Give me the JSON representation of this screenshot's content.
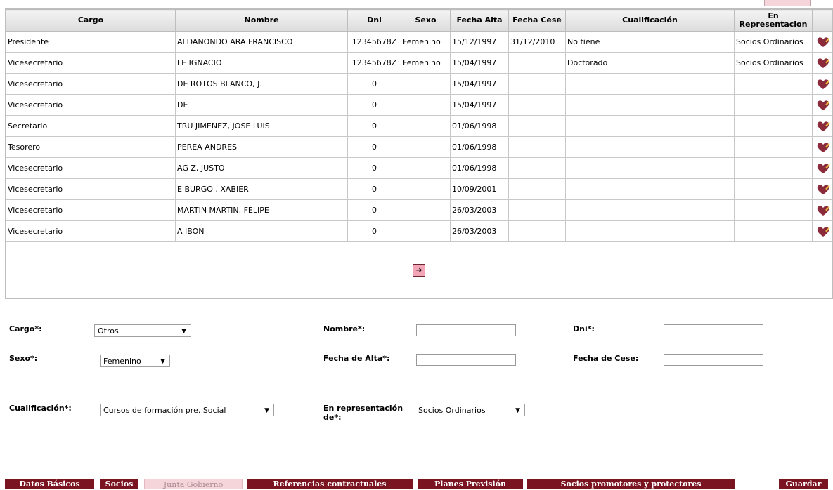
{
  "table": {
    "headers": {
      "cargo": "Cargo",
      "nombre": "Nombre",
      "dni": "Dni",
      "sexo": "Sexo",
      "fecha_alta": "Fecha Alta",
      "fecha_cese": "Fecha Cese",
      "cualificacion": "Cualificación",
      "en_representacion": "En Representacion"
    },
    "rows": [
      {
        "cargo": "Presidente",
        "nombre": "ALDANONDO ARA FRANCISCO",
        "dni": "12345678Z",
        "sexo": "Femenino",
        "fecha_alta": "15/12/1997",
        "fecha_cese": "31/12/2010",
        "cualificacion": "No tiene",
        "en_representacion": "Socios Ordinarios"
      },
      {
        "cargo": "Vicesecretario",
        "nombre": "LE          IGNACIO",
        "dni": "12345678Z",
        "sexo": "Femenino",
        "fecha_alta": "15/04/1997",
        "fecha_cese": "",
        "cualificacion": "Doctorado",
        "en_representacion": "Socios Ordinarios"
      },
      {
        "cargo": "Vicesecretario",
        "nombre": "DE  ROTOS BLANCO, J.",
        "dni": "0",
        "sexo": "",
        "fecha_alta": "15/04/1997",
        "fecha_cese": "",
        "cualificacion": "",
        "en_representacion": ""
      },
      {
        "cargo": "Vicesecretario",
        "nombre": "DE",
        "dni": "0",
        "sexo": "",
        "fecha_alta": "15/04/1997",
        "fecha_cese": "",
        "cualificacion": "",
        "en_representacion": ""
      },
      {
        "cargo": "Secretario",
        "nombre": "TRU   JIMENEZ, JOSE LUIS",
        "dni": "0",
        "sexo": "",
        "fecha_alta": "01/06/1998",
        "fecha_cese": "",
        "cualificacion": "",
        "en_representacion": ""
      },
      {
        "cargo": "Tesorero",
        "nombre": "PEREA   ANDRES",
        "dni": "0",
        "sexo": "",
        "fecha_alta": "01/06/1998",
        "fecha_cese": "",
        "cualificacion": "",
        "en_representacion": ""
      },
      {
        "cargo": "Vicesecretario",
        "nombre": "AG         Z, JUSTO",
        "dni": "0",
        "sexo": "",
        "fecha_alta": "01/06/1998",
        "fecha_cese": "",
        "cualificacion": "",
        "en_representacion": ""
      },
      {
        "cargo": "Vicesecretario",
        "nombre": "E       BURGO   , XABIER",
        "dni": "0",
        "sexo": "",
        "fecha_alta": "10/09/2001",
        "fecha_cese": "",
        "cualificacion": "",
        "en_representacion": ""
      },
      {
        "cargo": "Vicesecretario",
        "nombre": "MARTIN MARTIN, FELIPE",
        "dni": "0",
        "sexo": "",
        "fecha_alta": "26/03/2003",
        "fecha_cese": "",
        "cualificacion": "",
        "en_representacion": ""
      },
      {
        "cargo": "Vicesecretario",
        "nombre": "A             IBON",
        "dni": "0",
        "sexo": "",
        "fecha_alta": "26/03/2003",
        "fecha_cese": "",
        "cualificacion": "",
        "en_representacion": ""
      }
    ],
    "edit_icon": "edit-heart-pencil-icon",
    "next_icon": "arrow-right-icon"
  },
  "form": {
    "cargo_label": "Cargo*:",
    "cargo_value": "Otros",
    "nombre_label": "Nombre*:",
    "nombre_value": "",
    "dni_label": "Dni*:",
    "dni_value": "",
    "sexo_label": "Sexo*:",
    "sexo_value": "Femenino",
    "fecha_alta_label": "Fecha de Alta*:",
    "fecha_alta_value": "",
    "fecha_cese_label": "Fecha de Cese:",
    "fecha_cese_value": "",
    "cualificacion_label": "Cualificación*:",
    "cualificacion_value": "Cursos de formación pre. Social",
    "representacion_label": "En representación de*:",
    "representacion_value": "Socios Ordinarios"
  },
  "nav": {
    "datos_basicos": "Datos Básicos",
    "socios": "Socios",
    "junta_gobierno": "Junta Gobierno",
    "referencias": "Referencias contractuales",
    "planes": "Planes Previsión",
    "promotores": "Socios promotores y protectores",
    "guardar": "Guardar"
  },
  "colors": {
    "accent": "#7a1420",
    "active_tab": "#f6d5da",
    "icon_red": "#8b2a3a"
  }
}
